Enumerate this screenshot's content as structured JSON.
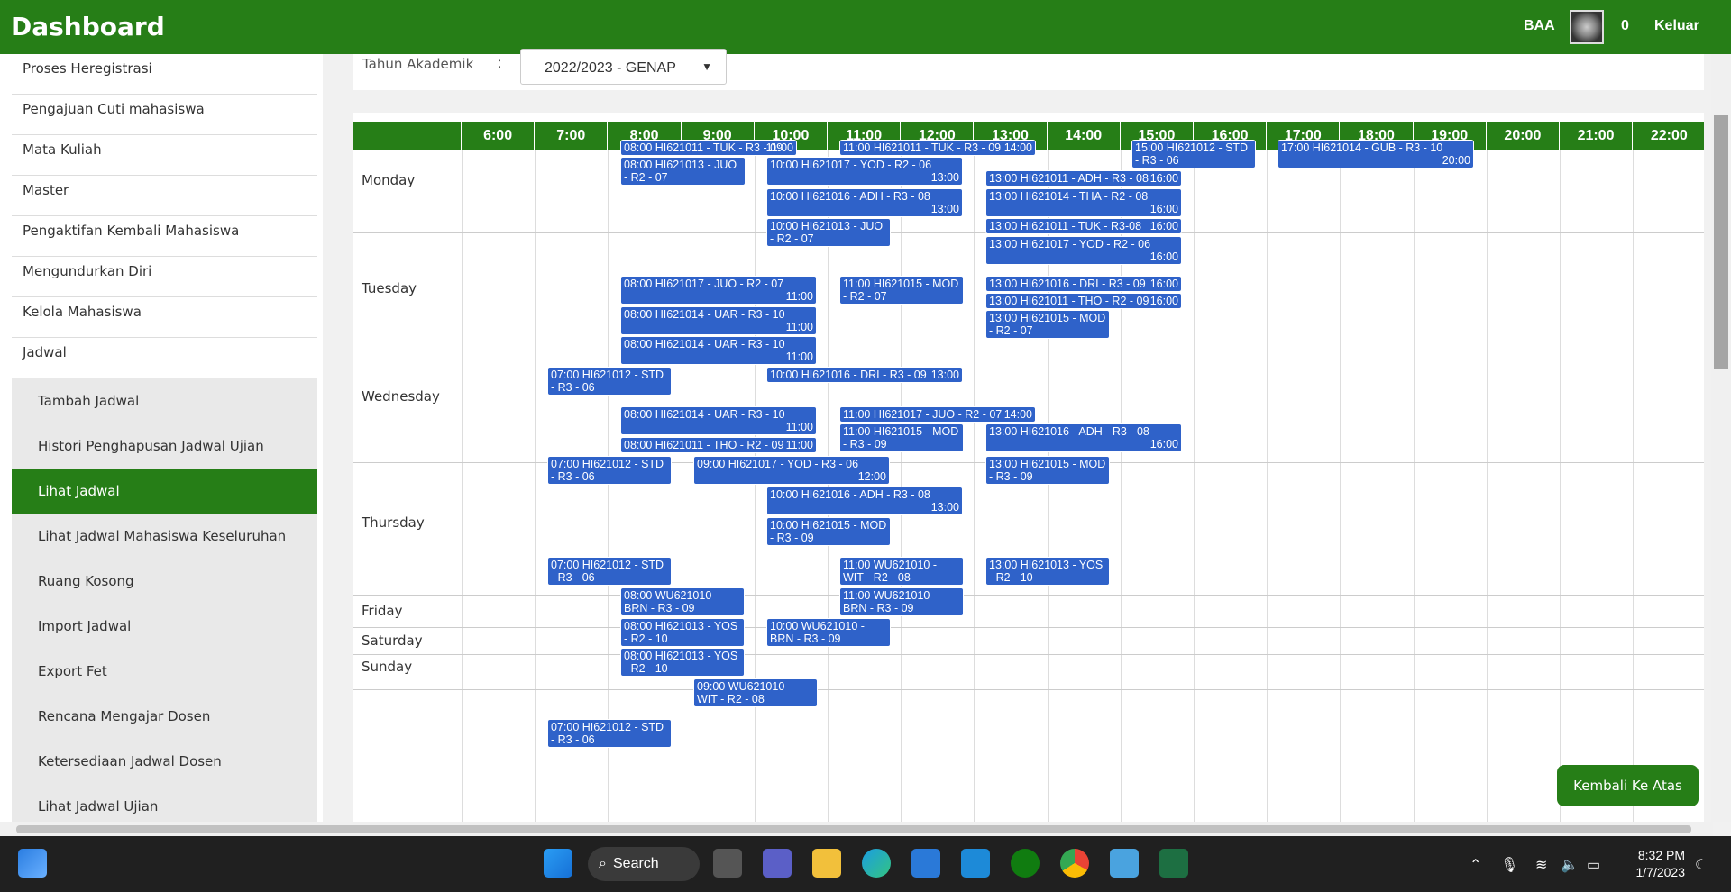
{
  "header": {
    "title": "Dashboard",
    "user": "BAA",
    "count": "0",
    "logout": "Keluar"
  },
  "sidebar": {
    "items": [
      "Proses Heregistrasi",
      "Pengajuan Cuti mahasiswa",
      "Mata Kuliah",
      "Master",
      "Pengaktifan Kembali Mahasiswa",
      "Mengundurkan Diri",
      "Kelola Mahasiswa",
      "Jadwal"
    ],
    "subitems": [
      "Tambah Jadwal",
      "Histori Penghapusan Jadwal Ujian",
      "Lihat Jadwal",
      "Lihat Jadwal Mahasiswa Keseluruhan",
      "Ruang Kosong",
      "Import Jadwal",
      "Export Fet",
      "Rencana Mengajar Dosen",
      "Ketersediaan Jadwal Dosen",
      "Lihat Jadwal Ujian"
    ],
    "active": "Lihat Jadwal"
  },
  "filter": {
    "label": "Tahun Akademik",
    "colon": ":",
    "selected": "2022/2023 - GENAP"
  },
  "schedule": {
    "hours": [
      "6:00",
      "7:00",
      "8:00",
      "9:00",
      "10:00",
      "11:00",
      "12:00",
      "13:00",
      "14:00",
      "15:00",
      "16:00",
      "17:00",
      "18:00",
      "19:00",
      "20:00",
      "21:00",
      "22:00"
    ],
    "days": [
      "Monday",
      "Tuesday",
      "Wednesday",
      "Thursday",
      "Friday",
      "Saturday",
      "Sunday"
    ],
    "events": [
      {
        "t1": "08:00 HI621011 - TUK - R3 - 09",
        "t2": "11:00"
      },
      {
        "t1": "08:00 HI621013 - JUO - R2 - 07",
        "t2": "10:00"
      },
      {
        "t1": "10:00 HI621017 - YOD - R2 - 06",
        "t2": "13:00"
      },
      {
        "t1": "10:00 HI621016 - ADH - R3 - 08",
        "t2": "13:00"
      },
      {
        "t1": "10:00 HI621013 - JUO - R2 - 07",
        "t2": "12:00"
      },
      {
        "t1": "11:00 HI621011 - TUK - R3 - 09",
        "t2": "14:00"
      },
      {
        "t1": "13:00 HI621011 - ADH - R3 - 08",
        "t2": "16:00"
      },
      {
        "t1": "13:00 HI621014 - THA - R2 - 08",
        "t2": "16:00"
      },
      {
        "t1": "13:00 HI621011 - TUK - R3-08",
        "t2": "16:00"
      },
      {
        "t1": "13:00 HI621017 - YOD - R2 - 06",
        "t2": "16:00"
      },
      {
        "t1": "15:00 HI621012 - STD - R3 - 06",
        "t2": "17:00"
      },
      {
        "t1": "17:00 HI621014 - GUB - R3 - 10",
        "t2": "20:00"
      },
      {
        "t1": "08:00 HI621017 - JUO - R2 - 07",
        "t2": "11:00"
      },
      {
        "t1": "08:00 HI621014 - UAR - R3 - 10",
        "t2": "11:00"
      },
      {
        "t1": "08:00 HI621014 - UAR - R3 - 10",
        "t2": "11:00"
      },
      {
        "t1": "07:00 HI621012 - STD - R3 - 06",
        "t2": "09:00"
      },
      {
        "t1": "11:00 HI621015 - MOD - R2 - 07",
        "t2": "13:00"
      },
      {
        "t1": "10:00 HI621016 - DRI - R3 - 09",
        "t2": "13:00"
      },
      {
        "t1": "13:00 HI621016 - DRI - R3 - 09",
        "t2": "16:00"
      },
      {
        "t1": "13:00 HI621011 - THO - R2 - 09",
        "t2": "16:00"
      },
      {
        "t1": "13:00 HI621015 - MOD - R2 - 07",
        "t2": "15:00"
      },
      {
        "t1": "08:00 HI621014 - UAR - R3 - 10",
        "t2": "11:00"
      },
      {
        "t1": "08:00 HI621011 - THO - R2 - 09",
        "t2": "11:00"
      },
      {
        "t1": "07:00 HI621012 - STD - R3 - 06",
        "t2": "09:00"
      },
      {
        "t1": "09:00 HI621017 - YOD - R3 - 06",
        "t2": "12:00"
      },
      {
        "t1": "10:00 HI621016 - ADH - R3 - 08",
        "t2": "13:00"
      },
      {
        "t1": "10:00 HI621015 - MOD - R3 - 09",
        "t2": "12:00"
      },
      {
        "t1": "11:00 HI621017 - JUO - R2 - 07",
        "t2": "14:00"
      },
      {
        "t1": "11:00 HI621015 - MOD - R3 - 09",
        "t2": "13:00"
      },
      {
        "t1": "13:00 HI621016 - ADH - R3 - 08",
        "t2": "16:00"
      },
      {
        "t1": "13:00 HI621015 - MOD - R3 - 09",
        "t2": "15:00"
      },
      {
        "t1": "07:00 HI621012 - STD - R3 - 06",
        "t2": "09:00"
      },
      {
        "t1": "08:00 WU621010 - BRN - R3 - 09",
        "t2": "10:00"
      },
      {
        "t1": "08:00 HI621013 - YOS - R2 - 10",
        "t2": "10:00"
      },
      {
        "t1": "08:00 HI621013 - YOS - R2 - 10",
        "t2": "10:00"
      },
      {
        "t1": "09:00 WU621010 - WIT - R2 - 08",
        "t2": "11:00"
      },
      {
        "t1": "10:00 WU621010 - BRN - R3 - 09",
        "t2": "12:00"
      },
      {
        "t1": "11:00 WU621010 - WIT - R2 - 08",
        "t2": "13:00"
      },
      {
        "t1": "11:00 WU621010 - BRN - R3 - 09",
        "t2": "13:00"
      },
      {
        "t1": "13:00 HI621013 - YOS - R2 - 10",
        "t2": "15:00"
      },
      {
        "t1": "07:00 HI621012 - STD - R3 - 06",
        "t2": "09:00"
      }
    ]
  },
  "back_to_top": "Kembali Ke Atas",
  "taskbar": {
    "search": "Search",
    "time": "8:32 PM",
    "date": "1/7/2023"
  }
}
